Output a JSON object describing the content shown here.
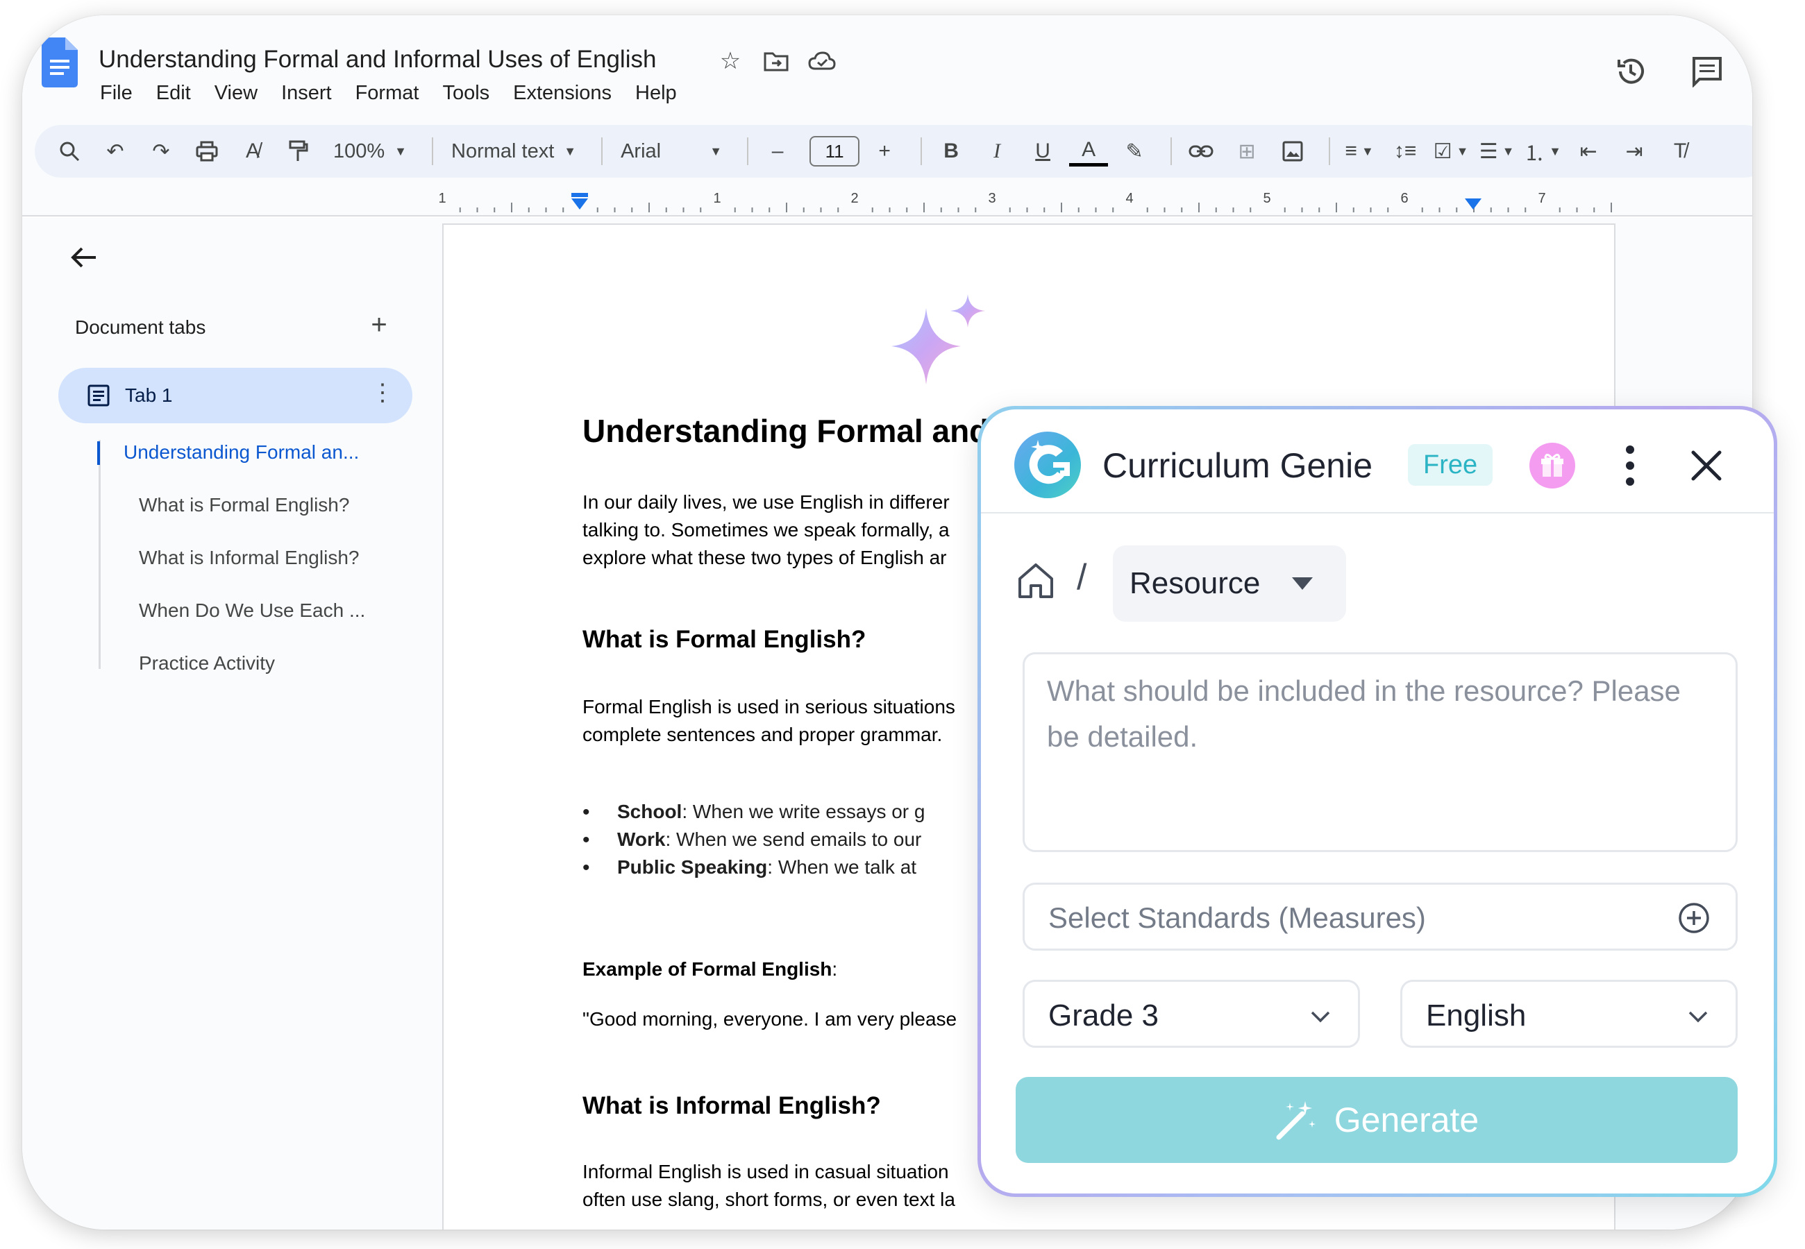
{
  "app": {
    "doc_title": "Understanding Formal and Informal Uses of English",
    "menu": [
      "File",
      "Edit",
      "View",
      "Insert",
      "Format",
      "Tools",
      "Extensions",
      "Help"
    ]
  },
  "toolbar": {
    "zoom": "100%",
    "style": "Normal text",
    "font": "Arial",
    "font_size": "11"
  },
  "ruler": {
    "numbers": [
      "1",
      "1",
      "2",
      "3",
      "4",
      "5",
      "6",
      "7"
    ]
  },
  "sidebar": {
    "header": "Document tabs",
    "tab_label": "Tab 1",
    "outline": [
      "Understanding Formal an...",
      "What is Formal English?",
      "What is Informal English?",
      "When Do We Use Each ...",
      "Practice Activity"
    ]
  },
  "document": {
    "title": "Understanding Formal and",
    "intro": [
      "In our daily lives, we use English in differer",
      "talking to. Sometimes we speak formally, a",
      "explore what these two types of English ar"
    ],
    "h_formal": "What is Formal English?",
    "formal_text": [
      "Formal English is used in serious situations",
      "complete sentences and proper grammar."
    ],
    "bullets": [
      {
        "bold": "School",
        "rest": ": When we write essays or g"
      },
      {
        "bold": "Work",
        "rest": ": When we send emails to our"
      },
      {
        "bold": "Public Speaking",
        "rest": ": When we talk at"
      }
    ],
    "example_label": "Example of Formal English",
    "example_colon": ":",
    "example_quote": "\"Good morning, everyone. I am very please",
    "h_informal": "What is Informal English?",
    "informal_text": [
      "Informal English is used in casual situation",
      "often use slang, short forms, or even text la"
    ]
  },
  "genie": {
    "name": "Curriculum Genie",
    "badge": "Free",
    "breadcrumb_separator": "/",
    "resource_label": "Resource",
    "prompt_placeholder": "What should be included in the resource? Please be detailed.",
    "standards_placeholder": "Select Standards (Measures)",
    "grade": "Grade 3",
    "subject": "English",
    "generate_label": "Generate",
    "colors": {
      "brand": "#2ab4c4",
      "generate_bg": "#8ed7df",
      "gift": "#f49cf0"
    }
  }
}
